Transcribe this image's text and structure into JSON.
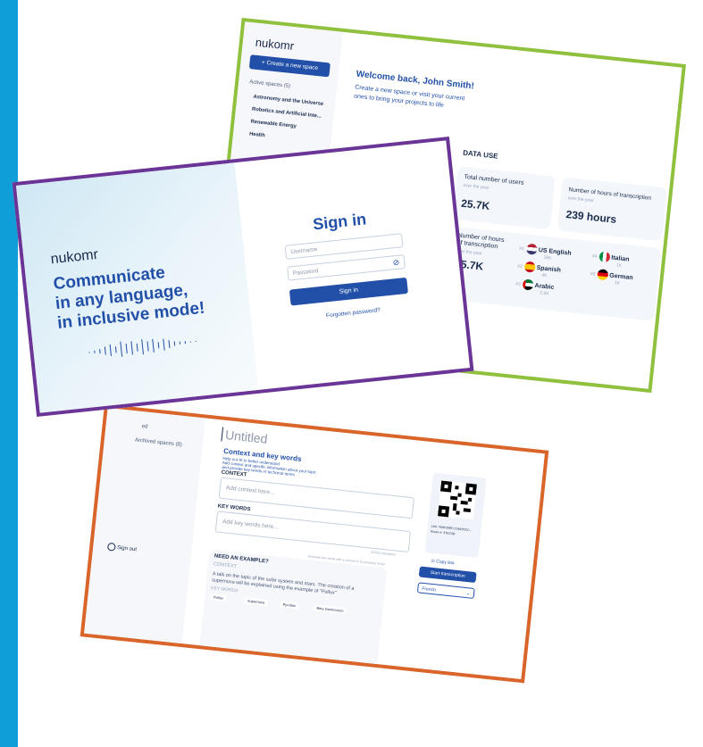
{
  "dashboard": {
    "logo": "nukomr",
    "create_button": "+ Create a new space",
    "active_spaces_label": "Active spaces (5)",
    "spaces": [
      "Astronomy and the Universe",
      "Robotics and Artificial Inte...",
      "Renewable Energy",
      "Health"
    ],
    "welcome_title": "Welcome back, John Smith!",
    "welcome_sub_1": "Create a new space or visit your current",
    "welcome_sub_2": "ones to bring your projects to life",
    "data_use_title": "DATA USE",
    "users_tile": {
      "title": "Total number of users",
      "sub": "over the year",
      "value": "25.7K"
    },
    "hours_tile": {
      "title": "Number of hours of transcription",
      "sub": "over the year",
      "value": "239 hours"
    },
    "lang_tile": {
      "title_1": "Number of hours",
      "title_2": "of transcription",
      "sub": "over the year",
      "value": "25.7K",
      "languages": [
        {
          "rank": "#1",
          "name": "US English",
          "count": "16K",
          "colors": [
            "#b22234",
            "#ffffff",
            "#3c3b6e"
          ]
        },
        {
          "rank": "#2",
          "name": "Spanish",
          "count": "4K",
          "colors": [
            "#c60b1e",
            "#ffc400",
            "#c60b1e"
          ]
        },
        {
          "rank": "#3",
          "name": "Arabic",
          "count": "2.6K",
          "colors": [
            "#00732f",
            "#ffffff",
            "#000000"
          ]
        },
        {
          "rank": "#4",
          "name": "Italian",
          "count": "1K",
          "colors": [
            "#009246",
            "#ffffff",
            "#ce2b37"
          ]
        },
        {
          "rank": "#5",
          "name": "German",
          "count": "1K",
          "colors": [
            "#000000",
            "#dd0000",
            "#ffce00"
          ]
        }
      ]
    }
  },
  "signin": {
    "logo": "nukomr",
    "tagline_1": "Communicate",
    "tagline_2": "in any language,",
    "tagline_3": "in inclusive mode!",
    "title": "Sign in",
    "username_placeholder": "Username",
    "password_placeholder": "Password",
    "button": "Sign in",
    "forgot": "Forgotten password?"
  },
  "editor": {
    "doc_title": "Untitled",
    "sidebar_item_1": "ed",
    "archived_spaces": "Archived spaces (8)",
    "sign_out": "Sign out",
    "context_title": "Context and key words",
    "context_help_1": "Help our AI to better understand",
    "context_help_2": "Add context and specific information about your topic",
    "context_help_3": "and provide key words or technical terms",
    "context_label": "CONTEXT",
    "context_placeholder": "Add context here...",
    "keywords_label": "KEY WORDS",
    "keywords_placeholder": "Add key words here...",
    "char_count": "0/1024 characters",
    "keywords_hint": "Separate key words with a comma or by pressing \"Enter\"",
    "example_title": "NEED AN EXAMPLE?",
    "example_context_label": "CONTEXT",
    "example_context_1": "A talk on the topic of the solar system and stars. The creation of a",
    "example_context_2": "supernova will be explained using the example of \"Pollux\"",
    "example_keywords_label": "KEY WORDS",
    "example_tags": [
      "Pollux",
      "Supernova",
      "Pyrolise",
      "Beta Geminorum"
    ],
    "link_line": "Link: NUKOMR.COM/3TEC...",
    "room_line": "Room #: 3TEC5B",
    "copy_link": "Copy link",
    "start_button": "Start transcription",
    "language_select": "French"
  }
}
